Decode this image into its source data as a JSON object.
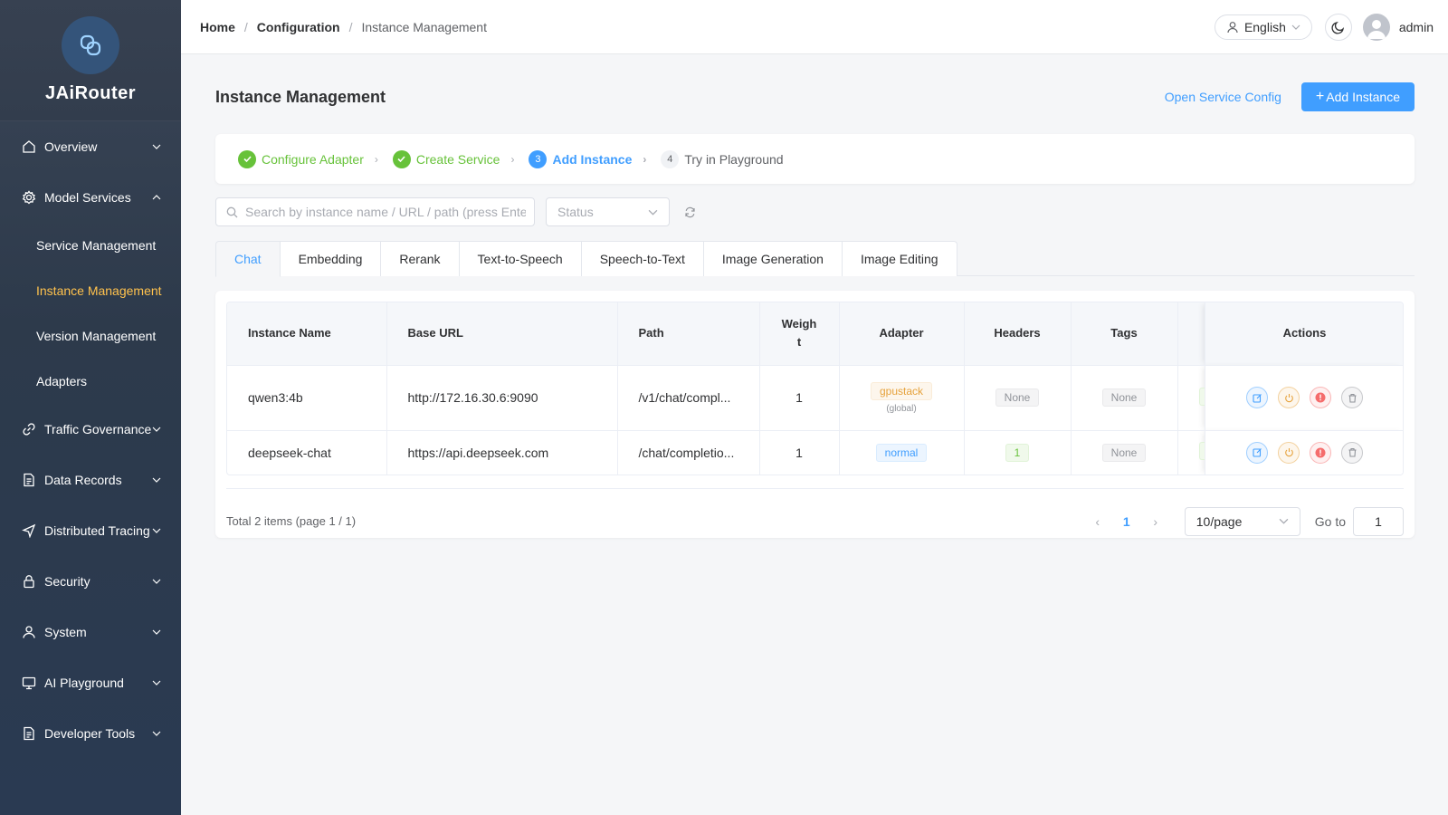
{
  "app": {
    "name": "JAiRouter"
  },
  "sidebar": {
    "items": [
      {
        "label": "Overview",
        "icon": "home-icon"
      },
      {
        "label": "Model Services",
        "icon": "gear-icon",
        "expanded": true,
        "children": [
          {
            "label": "Service Management"
          },
          {
            "label": "Instance Management",
            "active": true
          },
          {
            "label": "Version Management"
          },
          {
            "label": "Adapters"
          }
        ]
      },
      {
        "label": "Traffic Governance",
        "icon": "link-icon"
      },
      {
        "label": "Data Records",
        "icon": "document-icon"
      },
      {
        "label": "Distributed Tracing",
        "icon": "send-icon"
      },
      {
        "label": "Security",
        "icon": "lock-icon"
      },
      {
        "label": "System",
        "icon": "user-icon"
      },
      {
        "label": "AI Playground",
        "icon": "monitor-icon"
      },
      {
        "label": "Developer Tools",
        "icon": "document-icon"
      }
    ]
  },
  "header": {
    "breadcrumb": [
      "Home",
      "Configuration",
      "Instance Management"
    ],
    "language": "English",
    "username": "admin"
  },
  "page": {
    "title": "Instance Management",
    "open_config_label": "Open Service Config",
    "add_label": "Add Instance"
  },
  "steps": [
    {
      "label": "Configure Adapter",
      "state": "done"
    },
    {
      "label": "Create Service",
      "state": "done"
    },
    {
      "number": "3",
      "label": "Add Instance",
      "state": "current"
    },
    {
      "number": "4",
      "label": "Try in Playground",
      "state": "todo"
    }
  ],
  "filters": {
    "search_placeholder": "Search by instance name / URL / path (press Enter)",
    "status_placeholder": "Status"
  },
  "tabs": [
    "Chat",
    "Embedding",
    "Rerank",
    "Text-to-Speech",
    "Speech-to-Text",
    "Image Generation",
    "Image Editing"
  ],
  "active_tab": "Chat",
  "table": {
    "columns": {
      "name": "Instance Name",
      "base_url": "Base URL",
      "path": "Path",
      "weight_a": "Weigh",
      "weight_b": "t",
      "adapter": "Adapter",
      "headers": "Headers",
      "tags": "Tags",
      "actions": "Actions"
    },
    "rows": [
      {
        "name": "qwen3:4b",
        "base_url": "http://172.16.30.6:9090",
        "path": "/v1/chat/compl...",
        "weight": "1",
        "adapter": "gpustack",
        "adapter_scope": "(global)",
        "headers": "None",
        "tags": "None"
      },
      {
        "name": "deepseek-chat",
        "base_url": "https://api.deepseek.com",
        "path": "/chat/completio...",
        "weight": "1",
        "adapter": "normal",
        "headers": "1",
        "tags": "None"
      }
    ]
  },
  "pagination": {
    "total_text": "Total 2 items (page 1 / 1)",
    "current_page": "1",
    "page_size": "10/page",
    "goto_label": "Go to",
    "goto_value": "1"
  },
  "colors": {
    "primary": "#409eff",
    "success": "#67c23a",
    "warning": "#e6a23c",
    "danger": "#f56c6c",
    "sidebar_bg": "#2d3a4b",
    "sidebar_active": "#ffc24d"
  }
}
